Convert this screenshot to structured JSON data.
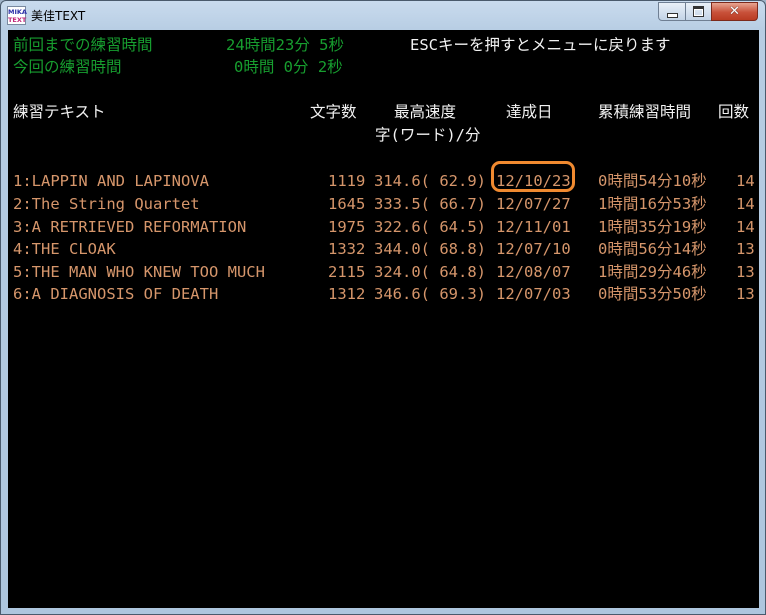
{
  "window": {
    "title": "美佳TEXT",
    "icon_text_1": "MIKA",
    "icon_text_2": "TEXT",
    "close_symbol": "✕"
  },
  "stats": {
    "prev_label": "前回までの練習時間",
    "prev_value": "24時間23分 5秒",
    "esc_hint": "ESCキーを押すとメニューに戻ります",
    "this_label": "今回の練習時間",
    "this_value": "0時間 0分 2秒"
  },
  "table": {
    "headers": {
      "text": "練習テキスト",
      "chars": "文字数",
      "speed": "最高速度",
      "speed_unit": "字(ワード)/分",
      "date": "達成日",
      "time": "累積練習時間",
      "count": "回数"
    },
    "rows": [
      {
        "title": "1:LAPPIN AND LAPINOVA",
        "chars": "1119",
        "speed": "314.6( 62.9)",
        "date": "12/10/23",
        "time": "0時間54分10秒",
        "count": "14"
      },
      {
        "title": "2:The String Quartet",
        "chars": "1645",
        "speed": "333.5( 66.7)",
        "date": "12/07/27",
        "time": "1時間16分53秒",
        "count": "14"
      },
      {
        "title": "3:A RETRIEVED REFORMATION",
        "chars": "1975",
        "speed": "322.6( 64.5)",
        "date": "12/11/01",
        "time": "1時間35分19秒",
        "count": "14"
      },
      {
        "title": "4:THE CLOAK",
        "chars": "1332",
        "speed": "344.0( 68.8)",
        "date": "12/07/10",
        "time": "0時間56分14秒",
        "count": "13"
      },
      {
        "title": "5:THE MAN WHO KNEW TOO MUCH",
        "chars": "2115",
        "speed": "324.0( 64.8)",
        "date": "12/08/07",
        "time": "1時間29分46秒",
        "count": "13"
      },
      {
        "title": "6:A DIAGNOSIS OF DEATH",
        "chars": "1312",
        "speed": "346.6( 69.3)",
        "date": "12/07/03",
        "time": "0時間53分50秒",
        "count": "13"
      }
    ]
  },
  "colors": {
    "background": "#000000",
    "green": "#179e2f",
    "header": "#f2f2f2",
    "row": "#d6966b",
    "highlight": "#f08a30"
  }
}
